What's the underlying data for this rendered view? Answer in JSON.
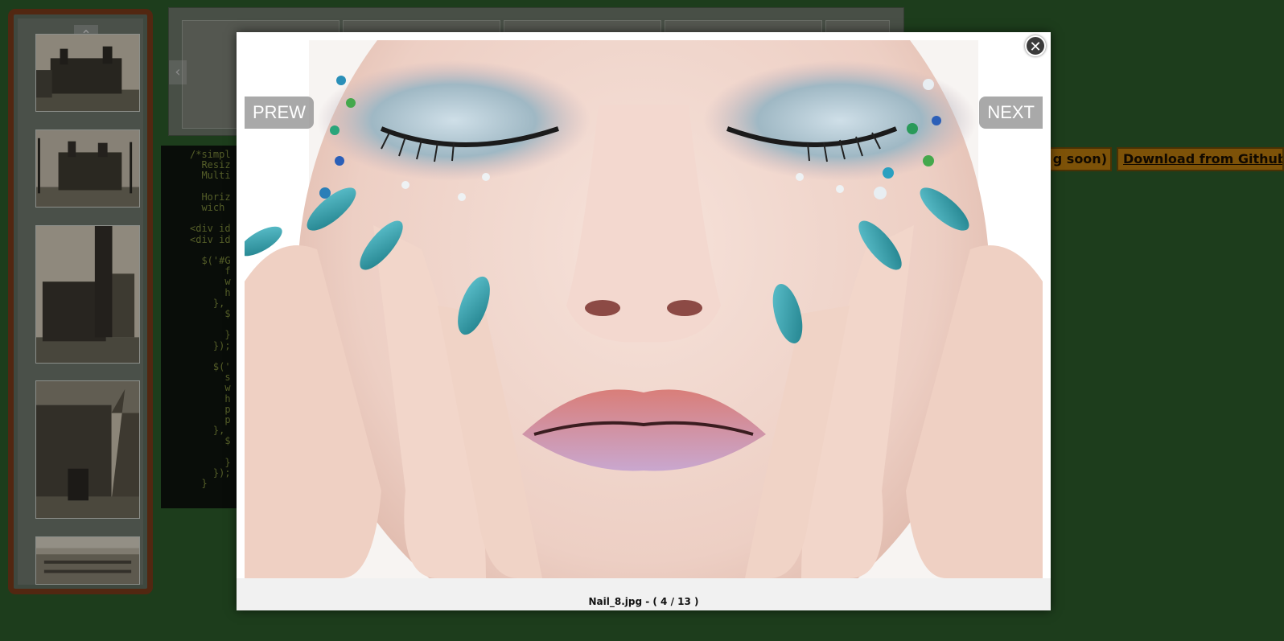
{
  "buttons": {
    "coming_soon": "g soon)",
    "github": "Download from Github"
  },
  "code_snippet": [
    "/*simpl",
    "  Resiz",
    "  Multi",
    "",
    "  Horiz",
    "  wich",
    "",
    "<div id",
    "<div id",
    "",
    "  $('#G",
    "      f",
    "      w",
    "      h",
    "    },",
    "      $",
    "",
    "      }",
    "    });",
    "",
    "    $('",
    "      s",
    "      w",
    "      h",
    "      p",
    "      p",
    "    },",
    "      $",
    "",
    "      }",
    "    });",
    "  }"
  ],
  "lightbox": {
    "prev_label": "PREW",
    "next_label": "NEXT",
    "close_icon": "close-icon",
    "caption": "Nail_8.jpg - ( 4 / 13 )"
  },
  "icons": {
    "up": "chevron-up-icon",
    "left": "chevron-left-icon"
  },
  "colors": {
    "page_bg": "#2b5a2a",
    "button_bg": "#b87a0c",
    "gallery_border": "#7a3a1a"
  }
}
